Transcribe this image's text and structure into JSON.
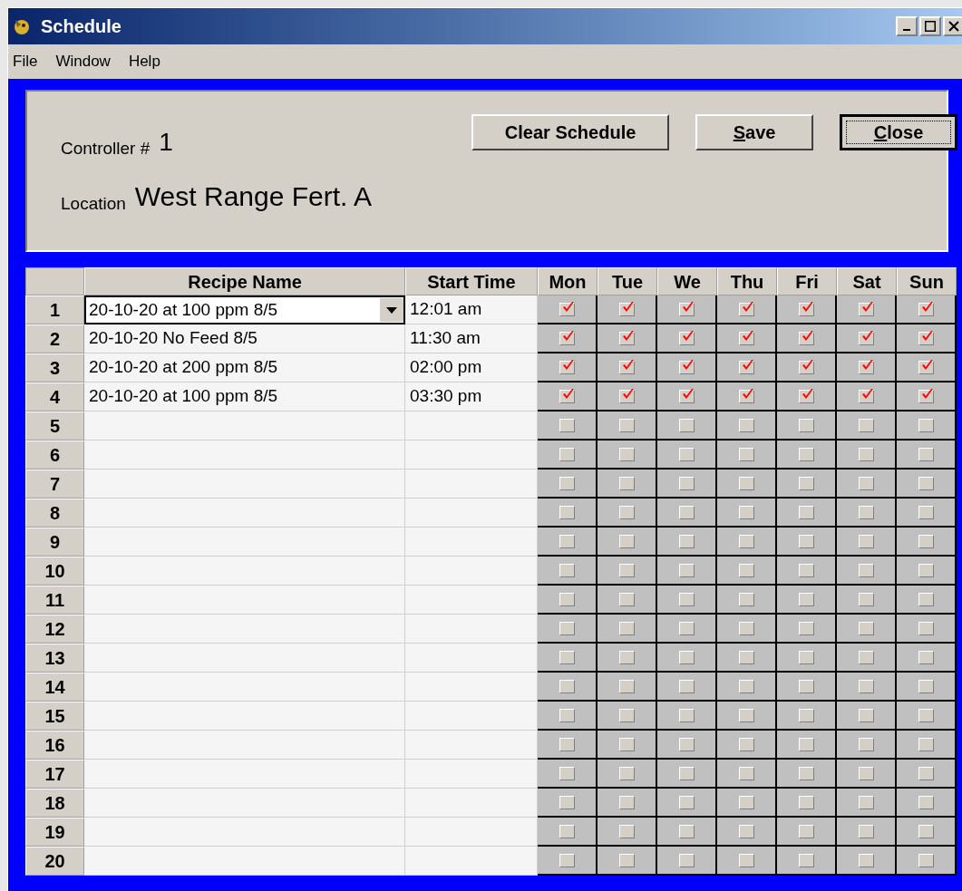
{
  "window": {
    "title": "Schedule"
  },
  "menu": [
    "File",
    "Window",
    "Help"
  ],
  "header": {
    "controller_label": "Controller #",
    "controller": "1",
    "location_label": "Location",
    "location": "West Range Fert. A"
  },
  "buttons": [
    {
      "label": "Clear Schedule",
      "underline_first": false,
      "focused": false
    },
    {
      "label": "Save",
      "underline_first": true,
      "focused": false
    },
    {
      "label": "Close",
      "underline_first": true,
      "focused": true
    }
  ],
  "columns": [
    "Recipe Name",
    "Start Time",
    "Mon",
    "Tue",
    "We",
    "Thu",
    "Fri",
    "Sat",
    "Sun"
  ],
  "rows": [
    {
      "number": "1",
      "recipe": "20-10-20 at 100 ppm 8/5",
      "start": "12:01 am",
      "editing": true,
      "days": [
        true,
        true,
        true,
        true,
        true,
        true,
        true
      ]
    },
    {
      "number": "2",
      "recipe": "20-10-20 No Feed 8/5",
      "start": "11:30 am",
      "editing": false,
      "days": [
        true,
        true,
        true,
        true,
        true,
        true,
        true
      ]
    },
    {
      "number": "3",
      "recipe": "20-10-20 at 200 ppm 8/5",
      "start": "02:00 pm",
      "editing": false,
      "days": [
        true,
        true,
        true,
        true,
        true,
        true,
        true
      ]
    },
    {
      "number": "4",
      "recipe": "20-10-20 at 100 ppm 8/5",
      "start": "03:30 pm",
      "editing": false,
      "days": [
        true,
        true,
        true,
        true,
        true,
        true,
        true
      ]
    },
    {
      "number": "5",
      "editing": false,
      "days": [
        false,
        false,
        false,
        false,
        false,
        false,
        false
      ]
    },
    {
      "number": "6",
      "editing": false,
      "days": [
        false,
        false,
        false,
        false,
        false,
        false,
        false
      ]
    },
    {
      "number": "7",
      "editing": false,
      "days": [
        false,
        false,
        false,
        false,
        false,
        false,
        false
      ]
    },
    {
      "number": "8",
      "editing": false,
      "days": [
        false,
        false,
        false,
        false,
        false,
        false,
        false
      ]
    },
    {
      "number": "9",
      "editing": false,
      "days": [
        false,
        false,
        false,
        false,
        false,
        false,
        false
      ]
    },
    {
      "number": "10",
      "editing": false,
      "days": [
        false,
        false,
        false,
        false,
        false,
        false,
        false
      ]
    },
    {
      "number": "11",
      "editing": false,
      "days": [
        false,
        false,
        false,
        false,
        false,
        false,
        false
      ]
    },
    {
      "number": "12",
      "editing": false,
      "days": [
        false,
        false,
        false,
        false,
        false,
        false,
        false
      ]
    },
    {
      "number": "13",
      "editing": false,
      "days": [
        false,
        false,
        false,
        false,
        false,
        false,
        false
      ]
    },
    {
      "number": "14",
      "editing": false,
      "days": [
        false,
        false,
        false,
        false,
        false,
        false,
        false
      ]
    },
    {
      "number": "15",
      "editing": false,
      "days": [
        false,
        false,
        false,
        false,
        false,
        false,
        false
      ]
    },
    {
      "number": "16",
      "editing": false,
      "days": [
        false,
        false,
        false,
        false,
        false,
        false,
        false
      ]
    },
    {
      "number": "17",
      "editing": false,
      "days": [
        false,
        false,
        false,
        false,
        false,
        false,
        false
      ]
    },
    {
      "number": "18",
      "editing": false,
      "days": [
        false,
        false,
        false,
        false,
        false,
        false,
        false
      ]
    },
    {
      "number": "19",
      "editing": false,
      "days": [
        false,
        false,
        false,
        false,
        false,
        false,
        false
      ]
    },
    {
      "number": "20",
      "editing": false,
      "days": [
        false,
        false,
        false,
        false,
        false,
        false,
        false
      ]
    }
  ]
}
